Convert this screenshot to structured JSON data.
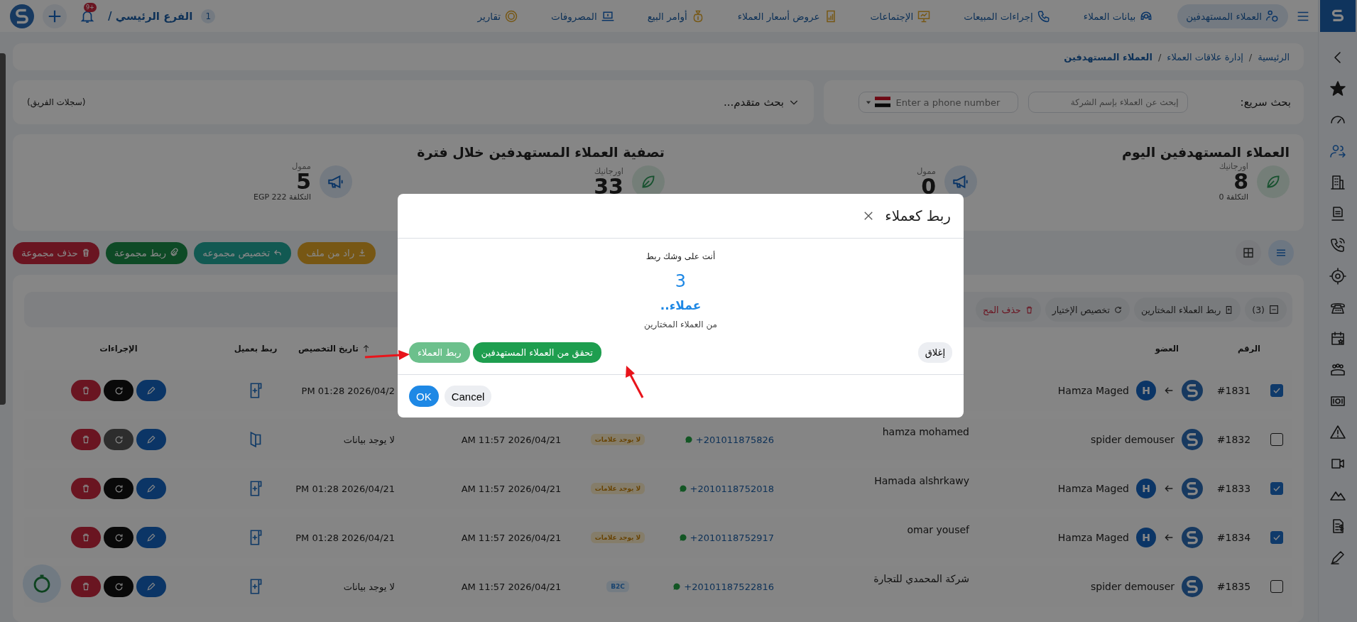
{
  "topbar": {
    "branch": "الفرع الرئيسي /",
    "branch_count": "1",
    "notifications": "+9",
    "nav": [
      {
        "label": "العملاء المستهدفين",
        "selected": true
      },
      {
        "label": "بيانات العملاء",
        "selected": false
      },
      {
        "label": "إجراءات المبيعات",
        "selected": false
      },
      {
        "label": "الإجتماعات",
        "selected": false
      },
      {
        "label": "عروض أسعار العملاء",
        "selected": false
      },
      {
        "label": "أوامر البيع",
        "selected": false
      },
      {
        "label": "المصروفات",
        "selected": false
      },
      {
        "label": "تقارير",
        "selected": false
      }
    ]
  },
  "sidebar": {
    "items": [
      {
        "selected": false
      },
      {
        "selected": false
      },
      {
        "selected": false
      },
      {
        "selected": true
      },
      {
        "selected": false
      },
      {
        "selected": false
      },
      {
        "selected": false
      },
      {
        "selected": false
      },
      {
        "selected": false
      },
      {
        "selected": false
      },
      {
        "selected": false
      },
      {
        "selected": false
      },
      {
        "selected": false
      },
      {
        "selected": false
      },
      {
        "selected": false
      },
      {
        "selected": false
      },
      {
        "selected": false
      }
    ]
  },
  "breadcrumb": {
    "separator": "/",
    "items": [
      {
        "label": "الرئيسية",
        "current": false
      },
      {
        "label": "إدارة علاقات العملاء",
        "current": false
      },
      {
        "label": "العملاء المستهدفين",
        "current": true
      }
    ]
  },
  "search": {
    "label": "بحث سريع:",
    "company_placeholder": "إبحث عن العملاء بإسم الشركة",
    "phone_placeholder": "Enter a phone number",
    "advanced": "بحث متقدم...",
    "team_records": "(سجلات الفريق)"
  },
  "stats": [
    {
      "title": "العملاء المستهدفين اليوم",
      "items": [
        {
          "kind": "organic",
          "label": "اورجانيك",
          "value": "8",
          "cost": "التكلفة 0"
        },
        {
          "kind": "paid",
          "label": "ممول",
          "value": "0"
        }
      ]
    },
    {
      "title": "تصفية العملاء المستهدفين خلال فترة",
      "items": [
        {
          "kind": "organic",
          "label": "اورجانيك",
          "value": "33"
        },
        {
          "kind": "paid",
          "label": "ممول",
          "value": "5",
          "cost": "التكلفة EGP 222"
        }
      ]
    }
  ],
  "view_toggle": [
    {
      "kind": "list",
      "selected": true
    },
    {
      "kind": "grid",
      "selected": false
    }
  ],
  "group_actions": [
    {
      "kind": "import",
      "label": "راد من ملف"
    },
    {
      "kind": "assign",
      "label": "تخصيص مجموعه"
    },
    {
      "kind": "link",
      "label": "ربط مجموعة"
    },
    {
      "kind": "delete",
      "label": "حذف مجموعة"
    }
  ],
  "selection_toolbar": {
    "count": "(3)",
    "actions": [
      {
        "kind": "link",
        "label": "ربط العملاء المختارين"
      },
      {
        "kind": "assign",
        "label": "تخصيص الإختيار"
      },
      {
        "kind": "delete",
        "label": "حذف المح"
      }
    ]
  },
  "table": {
    "columns": {
      "number": "الرقم",
      "member": "العضو",
      "assigned_at": "تاريخ التخصيص",
      "link": "ربط بعميل",
      "actions": "الإجراءات"
    },
    "rows": [
      {
        "checked": true,
        "number": "#1831",
        "member": {
          "kind": "assigned",
          "name": "Hamza Maged",
          "initial": "H"
        },
        "assigned_at": "PM 01:28 2026/04/2",
        "link_open": false,
        "refresh_disabled": false
      },
      {
        "checked": false,
        "number": "#1832",
        "member": {
          "kind": "owner",
          "name": "spider demouser"
        },
        "name": "hamza mohamed",
        "phone": "+201011875826",
        "tag": {
          "text": "لا يوجد علامات",
          "kind": "none"
        },
        "created_at": "AM 11:57 2026/04/21",
        "assigned_at": "لا يوجد بيانات",
        "link_open": true,
        "refresh_disabled": true
      },
      {
        "checked": true,
        "number": "#1833",
        "member": {
          "kind": "assigned",
          "name": "Hamza Maged",
          "initial": "H"
        },
        "name": "Hamada alshrkawy",
        "phone": "+2010118752018",
        "tag": {
          "text": "لا يوجد علامات",
          "kind": "none"
        },
        "created_at": "AM 11:57 2026/04/21",
        "assigned_at": "PM 01:28 2026/04/21",
        "link_open": false,
        "refresh_disabled": false
      },
      {
        "checked": true,
        "number": "#1834",
        "member": {
          "kind": "assigned",
          "name": "Hamza Maged",
          "initial": "H"
        },
        "name": "omar yousef",
        "phone": "+2010118752917",
        "tag": {
          "text": "لا يوجد علامات",
          "kind": "none"
        },
        "created_at": "AM 11:57 2026/04/21",
        "assigned_at": "PM 01:28 2026/04/21",
        "link_open": false,
        "refresh_disabled": false
      },
      {
        "checked": false,
        "number": "#1835",
        "member": {
          "kind": "owner",
          "name": "spider demouser"
        },
        "name": "شركة المحمدي للتجارة",
        "phone": "+20101187522816",
        "tag": {
          "text": "B2C",
          "kind": "b2c"
        },
        "created_at": "AM 11:57 2026/04/21",
        "assigned_at": "لا يوجد بيانات",
        "link_open": false,
        "refresh_disabled": false
      }
    ]
  },
  "modal": {
    "title": "ربط كعملاء",
    "message": "أنت على وشك ربط",
    "count": "3",
    "unit": "عملاء..",
    "subtitle": "من العملاء المختارين",
    "close": "إغلاق",
    "verify": "تحقق من العملاء المستهدفين",
    "link": "ربط العملاء",
    "ok": "OK",
    "cancel": "Cancel"
  }
}
